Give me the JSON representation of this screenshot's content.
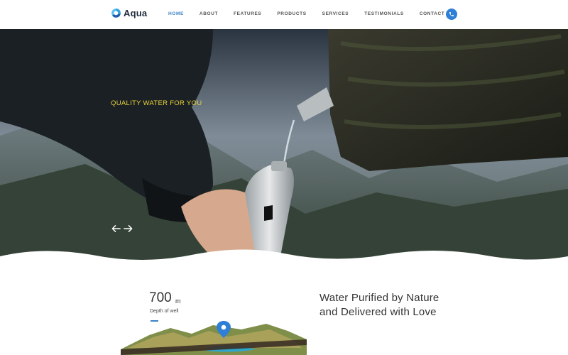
{
  "brand": {
    "name": "Aqua",
    "logo_icon": "water-drop-recycle-icon"
  },
  "nav": {
    "items": [
      {
        "label": "HOME",
        "active": true
      },
      {
        "label": "ABOUT",
        "active": false
      },
      {
        "label": "FEATURES",
        "active": false
      },
      {
        "label": "PRODUCTS",
        "active": false
      },
      {
        "label": "SERVICES",
        "active": false
      },
      {
        "label": "TESTIMONIALS",
        "active": false
      },
      {
        "label": "CONTACT US",
        "active": false
      }
    ],
    "phone_icon": "phone-icon"
  },
  "hero": {
    "tagline": "QUALITY WATER FOR YOU",
    "prev_icon": "arrow-left-icon",
    "next_icon": "arrow-right-icon"
  },
  "well": {
    "depth_value": "700",
    "depth_unit": "m",
    "depth_label": "Depth of well",
    "map_icon": "map-pin-icon"
  },
  "headline": {
    "line1": "Water Purified by Nature",
    "line2": "and Delivered with Love"
  },
  "colors": {
    "accent": "#3b82c4",
    "tagline": "#e7d23a",
    "phone_button": "#2f7fd6"
  }
}
